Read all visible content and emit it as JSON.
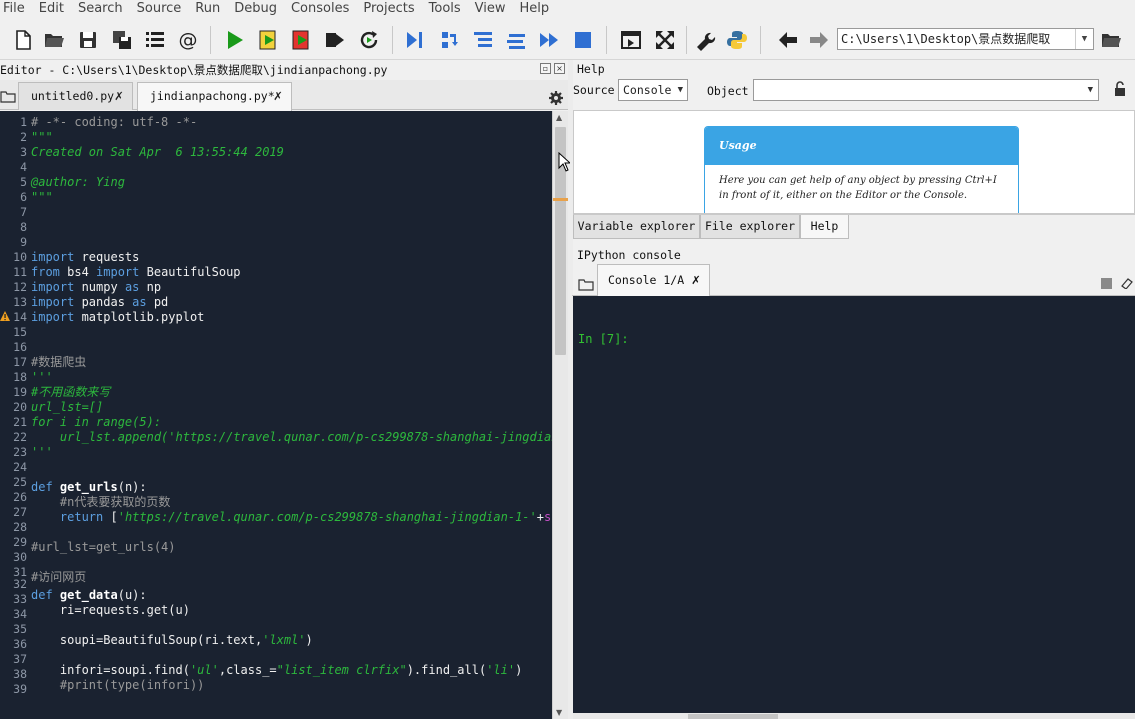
{
  "menu": [
    "File",
    "Edit",
    "Search",
    "Source",
    "Run",
    "Debug",
    "Consoles",
    "Projects",
    "Tools",
    "View",
    "Help"
  ],
  "toolbar": {
    "path": "C:\\Users\\1\\Desktop\\景点数据爬取",
    "icons": [
      "new-file-icon",
      "open-file-icon",
      "save-icon",
      "save-all-icon",
      "outline-icon",
      "at-sign-icon",
      "run-icon",
      "run-cell-icon",
      "run-cell-advance-icon",
      "run-selection-icon",
      "rerun-icon",
      "debug-icon",
      "step-icon",
      "step-into-icon",
      "step-return-icon",
      "continue-icon",
      "stop-icon",
      "maximize-pane-icon",
      "fullscreen-icon",
      "wrench-icon",
      "python-icon",
      "back-arrow-icon",
      "forward-arrow-icon",
      "browse-folder-icon"
    ]
  },
  "editor": {
    "title": "Editor - C:\\Users\\1\\Desktop\\景点数据爬取\\jindianpachong.py",
    "tabs": [
      {
        "label": "untitled0.py"
      },
      {
        "label": "jindianpachong.py*"
      }
    ],
    "line_numbers": [
      "1",
      "2",
      "3",
      "4",
      "5",
      "6",
      "7",
      "8",
      "9",
      "10",
      "11",
      "12",
      "13",
      "14",
      "15",
      "16",
      "17",
      "18",
      "19",
      "20",
      "21",
      "22",
      "23",
      "24",
      "25",
      "26",
      "27",
      "28",
      "29",
      "30",
      "31",
      "32",
      "33",
      "34",
      "35",
      "36",
      "37",
      "38",
      "39"
    ],
    "warning_line": "14"
  },
  "help": {
    "title": "Help",
    "source_label": "Source",
    "source_value": "Console",
    "object_label": "Object",
    "object_value": "",
    "usage_title": "Usage",
    "usage_text": "Here you can get help of any object by pressing Ctrl+I in front of it, either on the Editor or the Console."
  },
  "right_tabs": [
    "Variable explorer",
    "File explorer",
    "Help"
  ],
  "console": {
    "title": "IPython console",
    "tab_label": "Console 1/A",
    "prompt": "In [7]:"
  }
}
